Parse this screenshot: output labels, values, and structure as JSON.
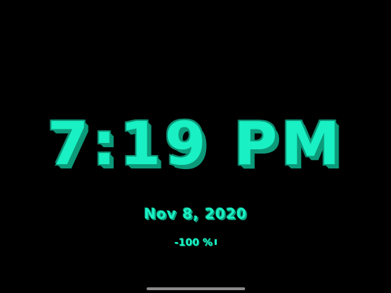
{
  "clock": {
    "time": "7:19 PM",
    "date": "Nov 8, 2020",
    "battery": "-100 %"
  },
  "colors": {
    "background": "#000000",
    "accent": "#19f0c3",
    "shadow": "#0c9a7a",
    "home_indicator": "#8a8a8a"
  },
  "icons": {
    "battery": "battery-icon",
    "home_indicator": "home-indicator"
  }
}
